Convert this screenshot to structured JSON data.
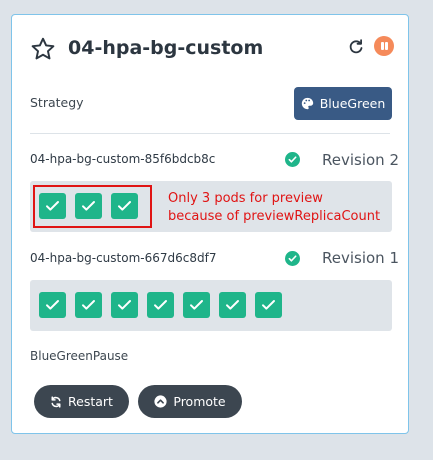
{
  "rollout": {
    "name": "04-hpa-bg-custom",
    "strategy_label": "Strategy",
    "strategy_value": "BlueGreen"
  },
  "replica_sets": [
    {
      "name": "04-hpa-bg-custom-85f6bdcb8c",
      "revision": "Revision 2",
      "status": "healthy",
      "pod_count": 3
    },
    {
      "name": "04-hpa-bg-custom-667d6c8df7",
      "revision": "Revision 1",
      "status": "healthy",
      "pod_count": 7
    }
  ],
  "annotation": {
    "line1": "Only 3 pods for preview",
    "line2": "because of previewReplicaCount"
  },
  "pause_condition": "BlueGreenPause",
  "actions": {
    "restart_label": "Restart",
    "promote_label": "Promote"
  },
  "colors": {
    "healthy": "#1fb58a",
    "strategy_button": "#395a85",
    "pause_button": "#f58a5a",
    "annotation": "#e01414",
    "action_button": "#3c4650"
  },
  "icons": {
    "favorite": "star-icon",
    "refresh": "refresh-icon",
    "pause": "pause-icon",
    "strategy": "palette-icon",
    "status": "check-circle-icon",
    "pod": "check-icon",
    "restart": "sync-icon",
    "promote": "chevron-up-circle-icon"
  }
}
